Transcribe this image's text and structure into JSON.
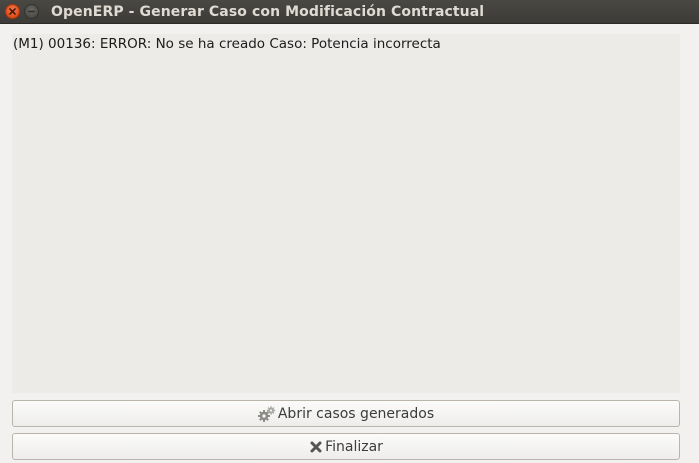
{
  "window": {
    "title": "OpenERP - Generar Caso con Modificación Contractual",
    "controls": {
      "close_icon": "close-icon",
      "minimize_icon": "minimize-icon"
    }
  },
  "message": {
    "text": "(M1) 00136: ERROR: No se ha creado Caso: Potencia incorrecta"
  },
  "buttons": {
    "open_cases": {
      "label": "Abrir casos generados",
      "icon": "gears-icon"
    },
    "finish": {
      "label": "Finalizar",
      "icon": "cross-icon"
    }
  },
  "colors": {
    "titlebar": "#3c3b37",
    "close_button": "#df4b16",
    "background": "#f2f1f0",
    "message_area": "#edebe8"
  }
}
